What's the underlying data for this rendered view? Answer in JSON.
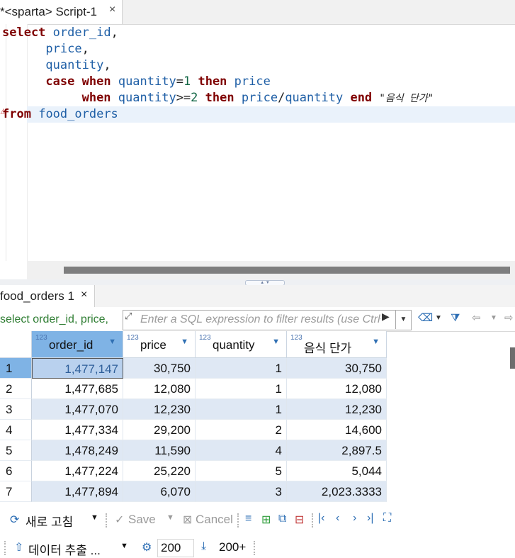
{
  "editor": {
    "tab_label": "*<sparta> Script-1",
    "tab_close": "×"
  },
  "sql_lines": [
    {
      "parts": [
        {
          "c": "kw",
          "t": "select"
        },
        {
          "c": "op",
          "t": " "
        },
        {
          "c": "id",
          "t": "order_id"
        },
        {
          "c": "op",
          "t": ","
        }
      ]
    },
    {
      "parts": [
        {
          "c": "op",
          "t": "      "
        },
        {
          "c": "id",
          "t": "price"
        },
        {
          "c": "op",
          "t": ","
        }
      ]
    },
    {
      "parts": [
        {
          "c": "op",
          "t": "      "
        },
        {
          "c": "id",
          "t": "quantity"
        },
        {
          "c": "op",
          "t": ","
        }
      ]
    },
    {
      "parts": [
        {
          "c": "op",
          "t": "      "
        },
        {
          "c": "kw",
          "t": "case"
        },
        {
          "c": "op",
          "t": " "
        },
        {
          "c": "kw",
          "t": "when"
        },
        {
          "c": "op",
          "t": " "
        },
        {
          "c": "id",
          "t": "quantity"
        },
        {
          "c": "op",
          "t": "="
        },
        {
          "c": "num",
          "t": "1"
        },
        {
          "c": "op",
          "t": " "
        },
        {
          "c": "kw",
          "t": "then"
        },
        {
          "c": "op",
          "t": " "
        },
        {
          "c": "id",
          "t": "price"
        }
      ]
    },
    {
      "parts": [
        {
          "c": "op",
          "t": "           "
        },
        {
          "c": "kw",
          "t": "when"
        },
        {
          "c": "op",
          "t": " "
        },
        {
          "c": "id",
          "t": "quantity"
        },
        {
          "c": "op",
          "t": ">="
        },
        {
          "c": "num",
          "t": "2"
        },
        {
          "c": "op",
          "t": " "
        },
        {
          "c": "kw",
          "t": "then"
        },
        {
          "c": "op",
          "t": " "
        },
        {
          "c": "id",
          "t": "price"
        },
        {
          "c": "op",
          "t": "/"
        },
        {
          "c": "id",
          "t": "quantity"
        },
        {
          "c": "op",
          "t": " "
        },
        {
          "c": "kw",
          "t": "end"
        },
        {
          "c": "op",
          "t": " "
        },
        {
          "c": "str",
          "t": "\"음식 단가\""
        }
      ]
    },
    {
      "parts": [
        {
          "c": "kw",
          "t": "from"
        },
        {
          "c": "op",
          "t": " "
        },
        {
          "c": "id",
          "t": "food_orders"
        }
      ]
    }
  ],
  "results": {
    "tab_label": "food_orders 1",
    "tab_close": "×",
    "filter_sql": "select order_id, price,",
    "filter_placeholder": "Enter a SQL expression to filter results (use Ctrl+Space)",
    "columns": [
      {
        "type": "123",
        "name": "order_id"
      },
      {
        "type": "123",
        "name": "price"
      },
      {
        "type": "123",
        "name": "quantity"
      },
      {
        "type": "123",
        "name": "음식 단가"
      }
    ],
    "rows": [
      [
        "1",
        "1,477,147",
        "30,750",
        "1",
        "30,750"
      ],
      [
        "2",
        "1,477,685",
        "12,080",
        "1",
        "12,080"
      ],
      [
        "3",
        "1,477,070",
        "12,230",
        "1",
        "12,230"
      ],
      [
        "4",
        "1,477,334",
        "29,200",
        "2",
        "14,600"
      ],
      [
        "5",
        "1,478,249",
        "11,590",
        "4",
        "2,897.5"
      ],
      [
        "6",
        "1,477,224",
        "25,220",
        "5",
        "5,044"
      ],
      [
        "7",
        "1,477,894",
        "6,070",
        "3",
        "2,023.3333"
      ]
    ]
  },
  "toolbar": {
    "refresh_label": "새로 고침",
    "save_label": "Save",
    "cancel_label": "Cancel",
    "export_label": "데이터 추출 ...",
    "fetch_size": "200",
    "fetch_more_label": "200+"
  },
  "colors": {
    "keyword": "#7f0000",
    "identifier": "#1f5fa6",
    "row_alt": "#dfe8f4",
    "selected_cell": "#b9d1ee",
    "header_selected": "#7fb3e5"
  }
}
